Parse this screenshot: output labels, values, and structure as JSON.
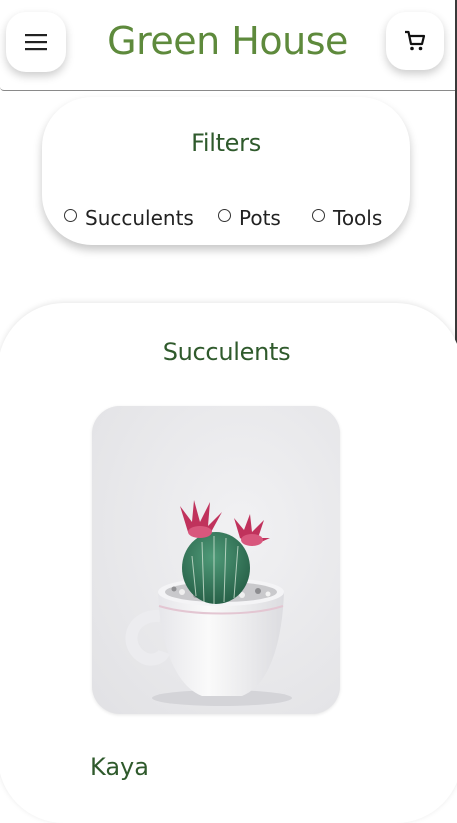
{
  "header": {
    "brand": "Green House",
    "menu_icon": "hamburger-icon",
    "cart_icon": "cart-icon"
  },
  "filters": {
    "title": "Filters",
    "options": [
      {
        "label": "Succulents",
        "selected": false
      },
      {
        "label": "Pots",
        "selected": false
      },
      {
        "label": "Tools",
        "selected": false
      }
    ]
  },
  "section": {
    "title": "Succulents",
    "products": [
      {
        "name": "Kaya",
        "image_icon": "cactus-in-cup-image"
      }
    ]
  },
  "colors": {
    "brand": "#5e8a3c",
    "heading": "#2f5a2c",
    "background": "#ffffff"
  }
}
